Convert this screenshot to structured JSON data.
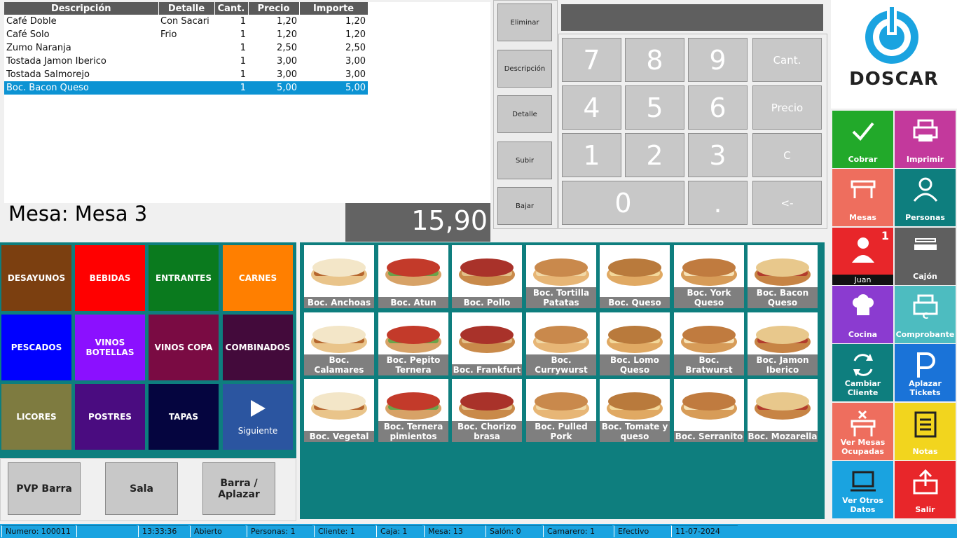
{
  "order": {
    "headers": [
      "Descripción",
      "Detalle",
      "Cant.",
      "Precio",
      "Importe"
    ],
    "rows": [
      [
        "Café Doble",
        "Con Sacari",
        "1",
        "1,20",
        "1,20"
      ],
      [
        "Café Solo",
        "Frio",
        "1",
        "1,20",
        "1,20"
      ],
      [
        "Zumo Naranja",
        "",
        "1",
        "2,50",
        "2,50"
      ],
      [
        "Tostada Jamon Iberico",
        "",
        "1",
        "3,00",
        "3,00"
      ],
      [
        "Tostada Salmorejo",
        "",
        "1",
        "3,00",
        "3,00"
      ],
      [
        "Boc. Bacon Queso",
        "",
        "1",
        "5,00",
        "5,00"
      ]
    ],
    "selected_row": 5
  },
  "mesa_label": "Mesa: Mesa 3",
  "total": "15,90",
  "side_buttons": [
    "Eliminar",
    "Descripción",
    "Detalle",
    "Subir",
    "Bajar"
  ],
  "keypad": {
    "digits": [
      "7",
      "8",
      "9",
      "4",
      "5",
      "6",
      "1",
      "2",
      "3",
      "0",
      "."
    ],
    "functions": [
      "Cant.",
      "Precio",
      "C",
      "<-"
    ]
  },
  "categories": [
    {
      "label": "DESAYUNOS",
      "color": "#7b3f10"
    },
    {
      "label": "BEBIDAS",
      "color": "#ff0000"
    },
    {
      "label": "ENTRANTES",
      "color": "#0a7a1e"
    },
    {
      "label": "CARNES",
      "color": "#ff7f00"
    },
    {
      "label": "PESCADOS",
      "color": "#0000ff"
    },
    {
      "label": "VINOS BOTELLAS",
      "color": "#8b10ff"
    },
    {
      "label": "VINOS COPA",
      "color": "#7a0b43"
    },
    {
      "label": "COMBINADOS",
      "color": "#430a3b"
    },
    {
      "label": "LICORES",
      "color": "#7e7b40"
    },
    {
      "label": "POSTRES",
      "color": "#4a0c80"
    },
    {
      "label": "TAPAS",
      "color": "#05053f"
    }
  ],
  "next_button": {
    "label": "Siguiente",
    "color": "#2b55a0"
  },
  "bottom_buttons": [
    "PVP Barra",
    "Sala",
    "Barra / Aplazar"
  ],
  "products": [
    "Boc. Anchoas",
    "Boc. Atun",
    "Boc. Pollo",
    "Boc. Tortilla Patatas",
    "Boc. Queso",
    "Boc. York Queso",
    "Boc. Bacon Queso",
    "Boc. Calamares",
    "Boc. Pepito Ternera",
    "Boc. Frankfurt",
    "Boc. Currywurst",
    "Boc. Lomo Queso",
    "Boc. Bratwurst",
    "Boc. Jamon Iberico",
    "Boc. Vegetal",
    "Boc. Ternera pimientos",
    "Boc. Chorizo brasa",
    "Boc. Pulled Pork",
    "Boc. Tomate y queso",
    "Boc. Serranito",
    "Boc. Mozarella"
  ],
  "logo": {
    "text": "DOSCAR",
    "color": "#1aa3e0"
  },
  "right_buttons": [
    {
      "label": "Cobrar",
      "color": "#22a92a",
      "icon": "check-icon"
    },
    {
      "label": "Imprimir",
      "color": "#c3399c",
      "icon": "printer-icon"
    },
    {
      "label": "Mesas",
      "color": "#ee6e5e",
      "icon": "table-icon"
    },
    {
      "label": "Personas",
      "color": "#0e7e7e",
      "icon": "person-icon"
    },
    {
      "label": "Juan",
      "color": "#e8262a",
      "icon": "waiter-icon",
      "badge": "1"
    },
    {
      "label": "Cajón",
      "color": "#5f5f5f",
      "icon": "drawer-icon"
    },
    {
      "label": "Cocina",
      "color": "#8b3bd0",
      "icon": "chef-hat-icon"
    },
    {
      "label": "Comprobante",
      "color": "#4dbcc0",
      "icon": "receipt-printer-icon"
    },
    {
      "label": "Cambiar Cliente",
      "color": "#0e7e7e",
      "icon": "swap-icon"
    },
    {
      "label": "Aplazar Tickets",
      "color": "#1a73d8",
      "icon": "parking-icon"
    },
    {
      "label": "Ver Mesas Ocupadas",
      "color": "#ee6e5e",
      "icon": "table-x-icon"
    },
    {
      "label": "Notas",
      "color": "#f2d51e",
      "icon": "notes-icon"
    },
    {
      "label": "Ver Otros Datos",
      "color": "#1aa3e0",
      "icon": "laptop-icon"
    },
    {
      "label": "Salir",
      "color": "#e8262a",
      "icon": "exit-icon"
    }
  ],
  "status": {
    "numero": "Numero: 100011",
    "blank": "",
    "time": "13:33:36",
    "estado": "Abierto",
    "personas": "Personas: 1",
    "cliente": "Cliente: 1",
    "caja": "Caja: 1",
    "mesa": "Mesa: 13",
    "salon": "Salón: 0",
    "camarero": "Camarero: 1",
    "pago": "Efectivo",
    "fecha": "11-07-2024"
  }
}
